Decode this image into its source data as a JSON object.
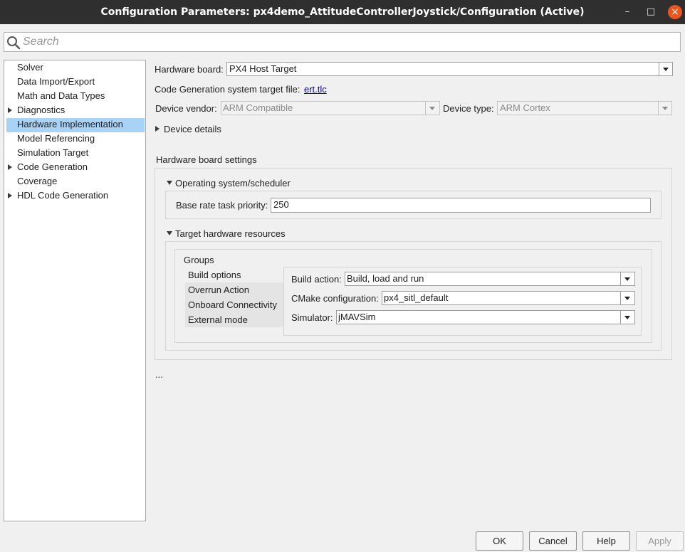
{
  "window": {
    "title": "Configuration Parameters: px4demo_AttitudeControllerJoystick/Configuration (Active)",
    "minimize_glyph": "–",
    "maximize_glyph": "□",
    "close_glyph": "×"
  },
  "search": {
    "placeholder": "Search"
  },
  "sidebar": {
    "items": [
      {
        "label": "Solver",
        "expandable": false
      },
      {
        "label": "Data Import/Export",
        "expandable": false
      },
      {
        "label": "Math and Data Types",
        "expandable": false
      },
      {
        "label": "Diagnostics",
        "expandable": true
      },
      {
        "label": "Hardware Implementation",
        "expandable": false,
        "selected": true
      },
      {
        "label": "Model Referencing",
        "expandable": false
      },
      {
        "label": "Simulation Target",
        "expandable": false
      },
      {
        "label": "Code Generation",
        "expandable": true
      },
      {
        "label": "Coverage",
        "expandable": false
      },
      {
        "label": "HDL Code Generation",
        "expandable": true
      }
    ]
  },
  "hardware": {
    "board_label": "Hardware board:",
    "board_value": "PX4 Host Target",
    "codegen_label": "Code Generation system target file:",
    "codegen_link": "ert.tlc",
    "vendor_label": "Device vendor:",
    "vendor_value": "ARM Compatible",
    "type_label": "Device type:",
    "type_value": "ARM Cortex",
    "device_details": "Device details",
    "board_settings_title": "Hardware board settings",
    "os_section": "Operating system/scheduler",
    "base_rate_label": "Base rate task priority:",
    "base_rate_value": "250",
    "target_section": "Target hardware resources",
    "groups_label": "Groups",
    "groups": [
      "Build options",
      "Overrun Action",
      "Onboard Connectivity",
      "External mode"
    ],
    "build_action_label": "Build action:",
    "build_action_value": "Build, load and run",
    "cmake_label": "CMake configuration:",
    "cmake_value": "px4_sitl_default",
    "simulator_label": "Simulator:",
    "simulator_value": "jMAVSim",
    "ellipsis": "..."
  },
  "buttons": {
    "ok": "OK",
    "cancel": "Cancel",
    "help": "Help",
    "apply": "Apply"
  },
  "colors": {
    "selection": "#a8d3f6",
    "close_button": "#e9541f",
    "titlebar": "#2f2f2f"
  }
}
